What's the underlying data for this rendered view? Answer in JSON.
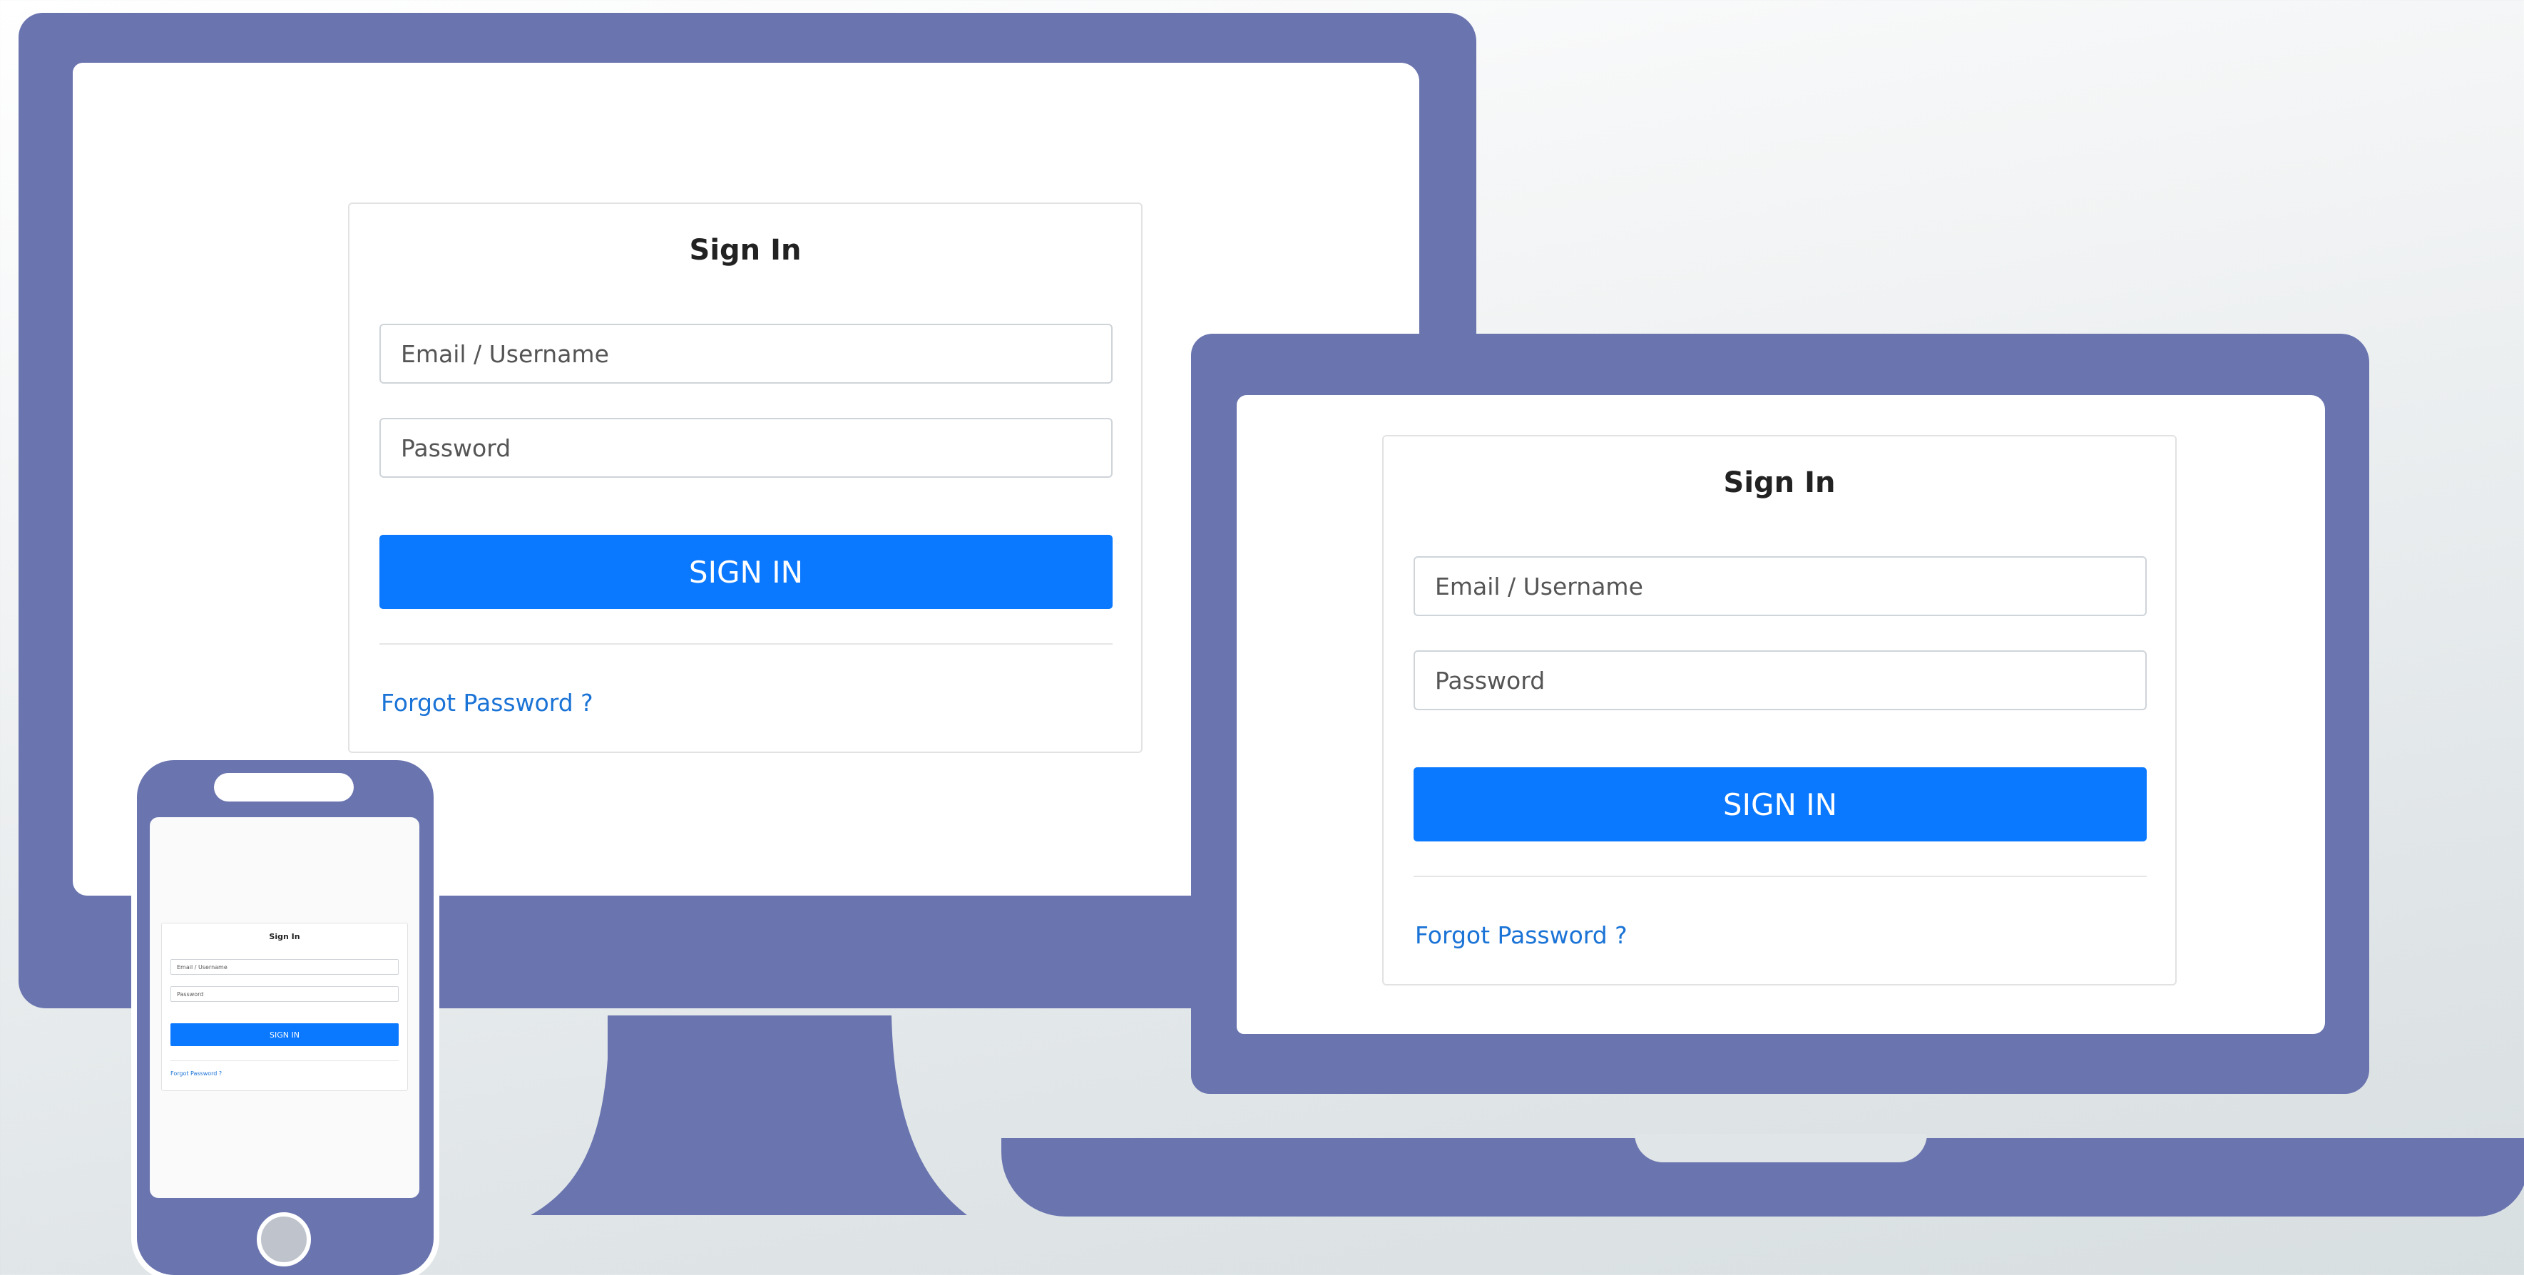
{
  "colors": {
    "device": "#6a74af",
    "accent": "#0a78ff",
    "link": "#1a73d6"
  },
  "login": {
    "title": "Sign In",
    "email_placeholder": "Email / Username",
    "password_placeholder": "Password",
    "button_label": "SIGN IN",
    "forgot_link": "Forgot Password ?"
  }
}
